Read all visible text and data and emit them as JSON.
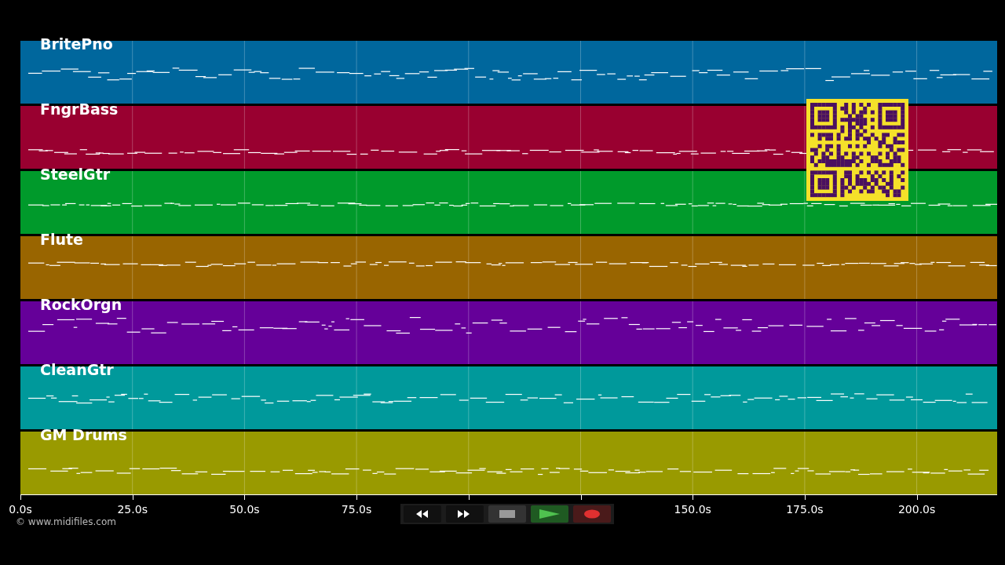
{
  "tracks": [
    {
      "name": "BritePno",
      "color": "#00679d"
    },
    {
      "name": "FngrBass",
      "color": "#990030"
    },
    {
      "name": "SteelGtr",
      "color": "#009a2b"
    },
    {
      "name": "Flute",
      "color": "#996500"
    },
    {
      "name": "RockOrgn",
      "color": "#650099"
    },
    {
      "name": "CleanGtr",
      "color": "#00999b"
    },
    {
      "name": "GM Drums",
      "color": "#999a00"
    }
  ],
  "time_axis": {
    "ticks": [
      {
        "label": "0.0s"
      },
      {
        "label": "25.0s"
      },
      {
        "label": "50.0s"
      },
      {
        "label": "75.0s"
      },
      {
        "covered": true
      },
      {
        "covered": true
      },
      {
        "label": "150.0s"
      },
      {
        "label": "175.0s"
      },
      {
        "label": "200.0s"
      }
    ]
  },
  "credit": "© www.midifiles.com",
  "transport": [
    {
      "kind": "rewind"
    },
    {
      "kind": "fast-forward"
    },
    {
      "kind": "stop"
    },
    {
      "kind": "play"
    },
    {
      "kind": "record"
    }
  ]
}
